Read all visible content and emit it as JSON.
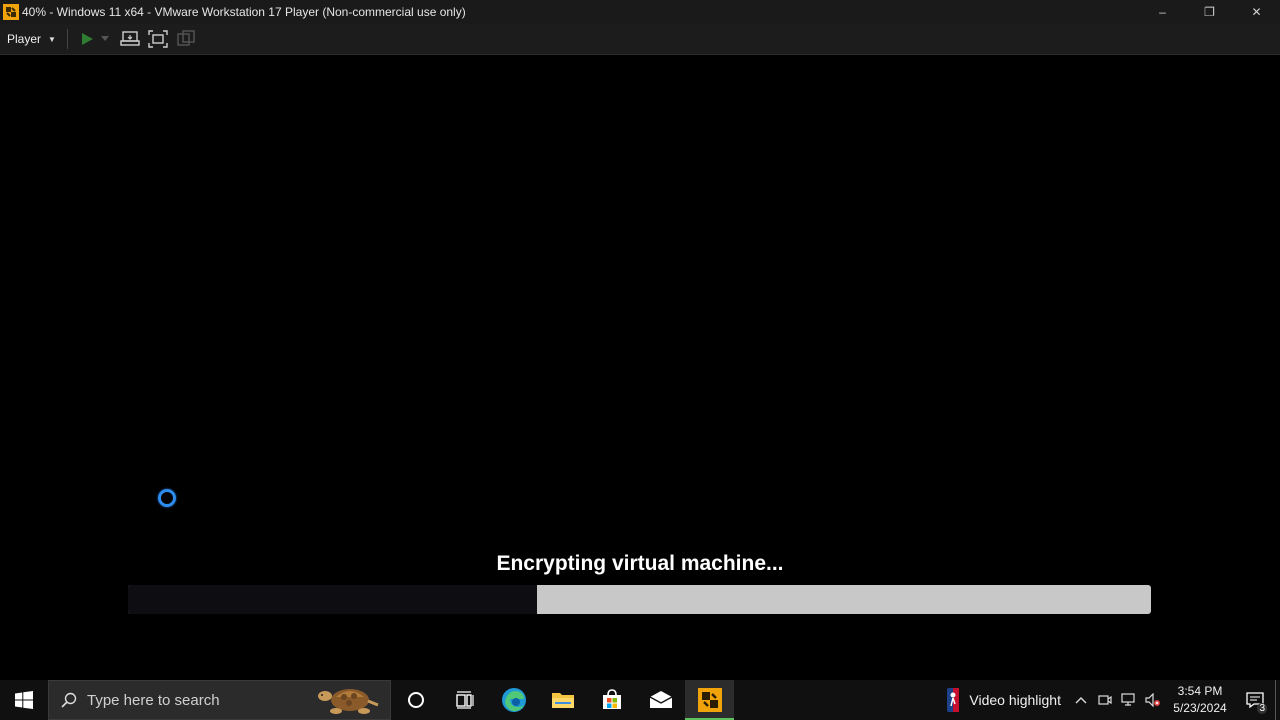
{
  "window": {
    "title": "40% - Windows 11 x64 - VMware Workstation 17 Player (Non-commercial use only)",
    "minimize_icon": "–",
    "restore_icon": "❐",
    "close_icon": "✕"
  },
  "toolbar": {
    "player_label": "Player",
    "icons": [
      "play-icon",
      "dropdown-caret-icon",
      "send-ctrl-alt-del-icon",
      "fullscreen-icon",
      "unity-icon"
    ]
  },
  "vm": {
    "status_text": "Encrypting virtual machine...",
    "progress": 0.4,
    "progress_fill_color": "#0d0d12",
    "progress_track_color": "#c8c8c8"
  },
  "taskbar": {
    "search_placeholder": "Type here to search",
    "apps": [
      "cortana-icon",
      "task-view-icon",
      "edge-icon",
      "file-explorer-icon",
      "store-icon",
      "mail-icon",
      "vmware-icon"
    ],
    "widget_label": "Video highlight",
    "clock_time": "3:54 PM",
    "clock_date": "5/23/2024",
    "notification_count": "3",
    "accent_color": "#5cc15c"
  }
}
